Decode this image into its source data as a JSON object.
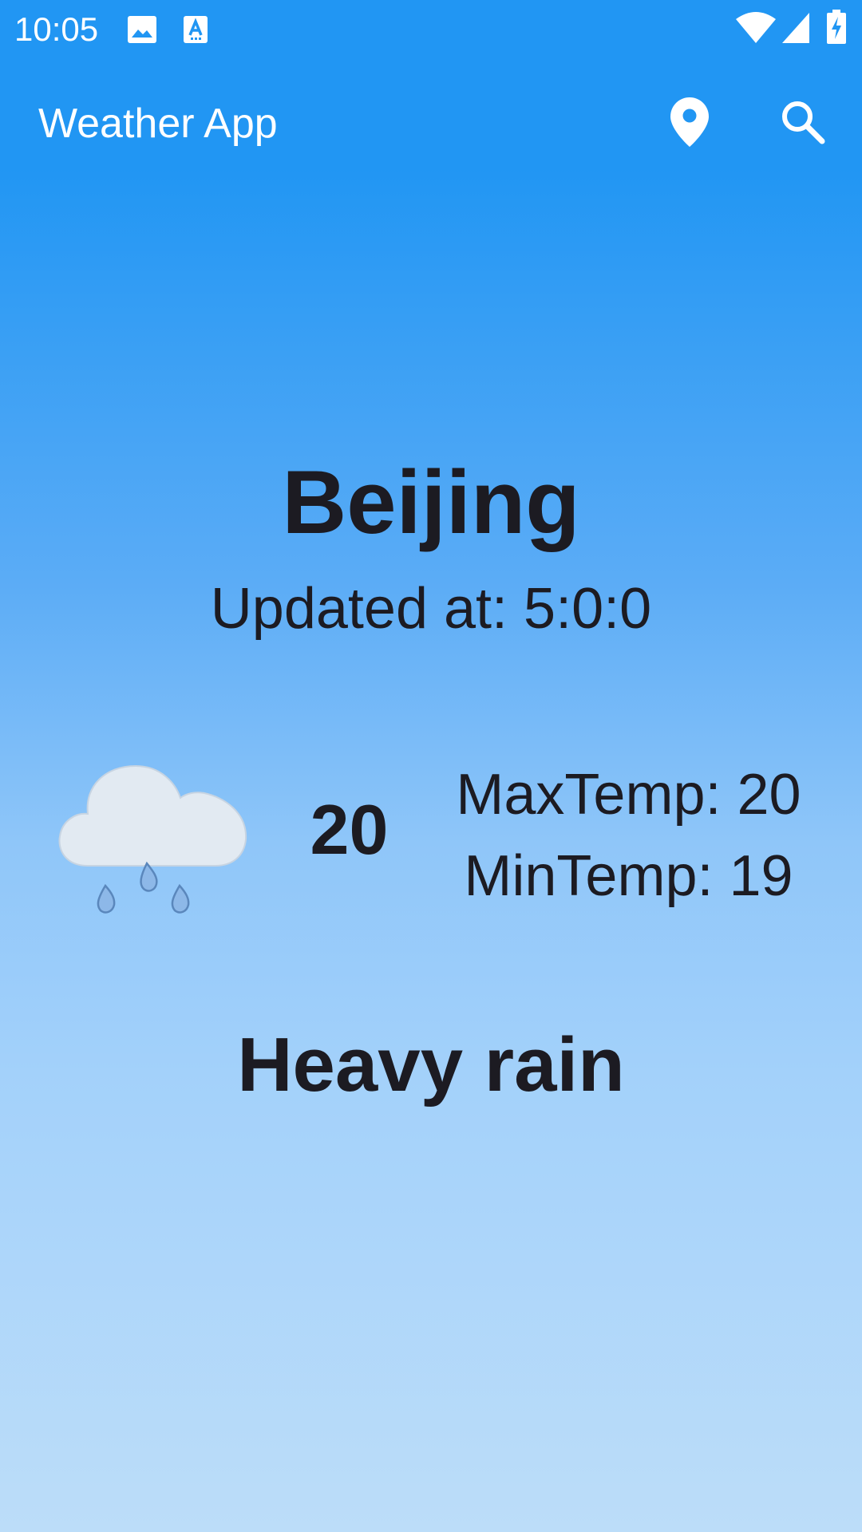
{
  "status_bar": {
    "time": "10:05",
    "icons": [
      "image-icon",
      "font-a-icon",
      "wifi-icon",
      "cell-signal-icon",
      "battery-charging-icon"
    ]
  },
  "app_bar": {
    "title": "Weather App",
    "actions": [
      "location-pin-icon",
      "search-icon"
    ]
  },
  "weather": {
    "city": "Beijing",
    "updated": "Updated at: 5:0:0",
    "current_temp": "20",
    "max_temp": "MaxTemp: 20",
    "min_temp": "MinTemp: 19",
    "condition": "Heavy rain",
    "icon": "heavy-rain-icon"
  },
  "colors": {
    "primary": "#2196F3",
    "text_dark": "#1c1b22",
    "gradient_bottom": "#BCDDF9"
  }
}
